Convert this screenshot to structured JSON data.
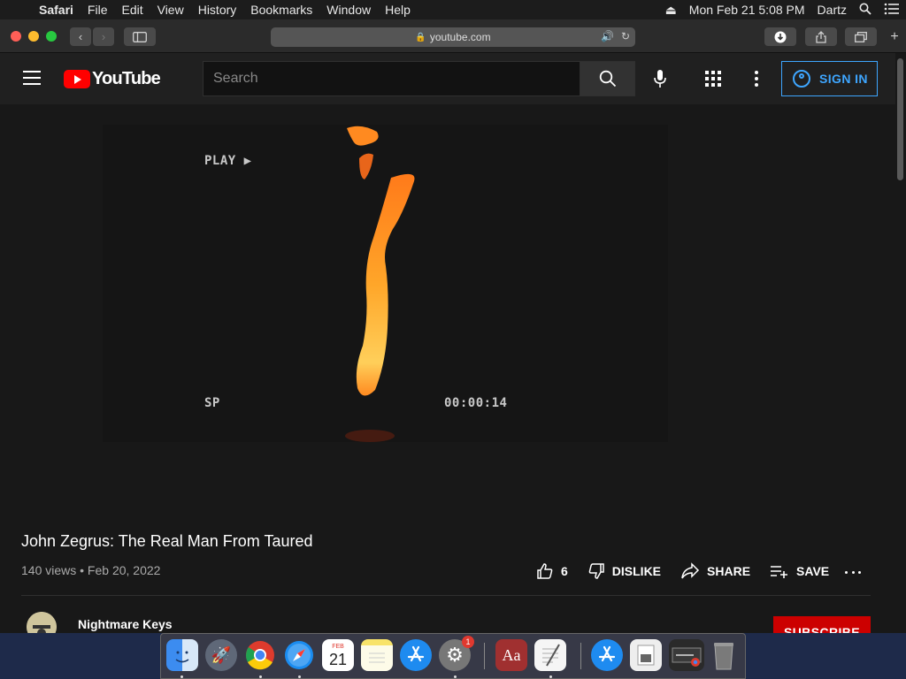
{
  "menubar": {
    "app_name": "Safari",
    "menus": [
      "File",
      "Edit",
      "View",
      "History",
      "Bookmarks",
      "Window",
      "Help"
    ],
    "datetime": "Mon Feb 21  5:08 PM",
    "user": "Dartz"
  },
  "safari": {
    "url": "youtube.com"
  },
  "youtube": {
    "logo_text": "YouTube",
    "search_placeholder": "Search",
    "sign_in": "SIGN IN",
    "video": {
      "osd_play": "PLAY ▶",
      "osd_speed": "SP",
      "osd_timecode": "00:00:14"
    },
    "title": "John Zegrus: The Real Man From Taured",
    "meta": "140 views • Feb 20, 2022",
    "actions": {
      "likes": "6",
      "dislike": "DISLIKE",
      "share": "SHARE",
      "save": "SAVE"
    },
    "channel": {
      "name": "Nightmare Keys"
    },
    "subscribe": "SUBSCRIBE"
  },
  "dock": {
    "items": [
      "finder",
      "launchpad",
      "chrome",
      "safari",
      "calendar",
      "notes",
      "app-store",
      "system-preferences",
      "dictionary",
      "textedit",
      "app-store-folder",
      "preview",
      "chrome-window",
      "trash"
    ],
    "calendar_month": "FEB",
    "calendar_day": "21",
    "system_prefs_badge": "1",
    "dictionary_label": "Aa"
  }
}
